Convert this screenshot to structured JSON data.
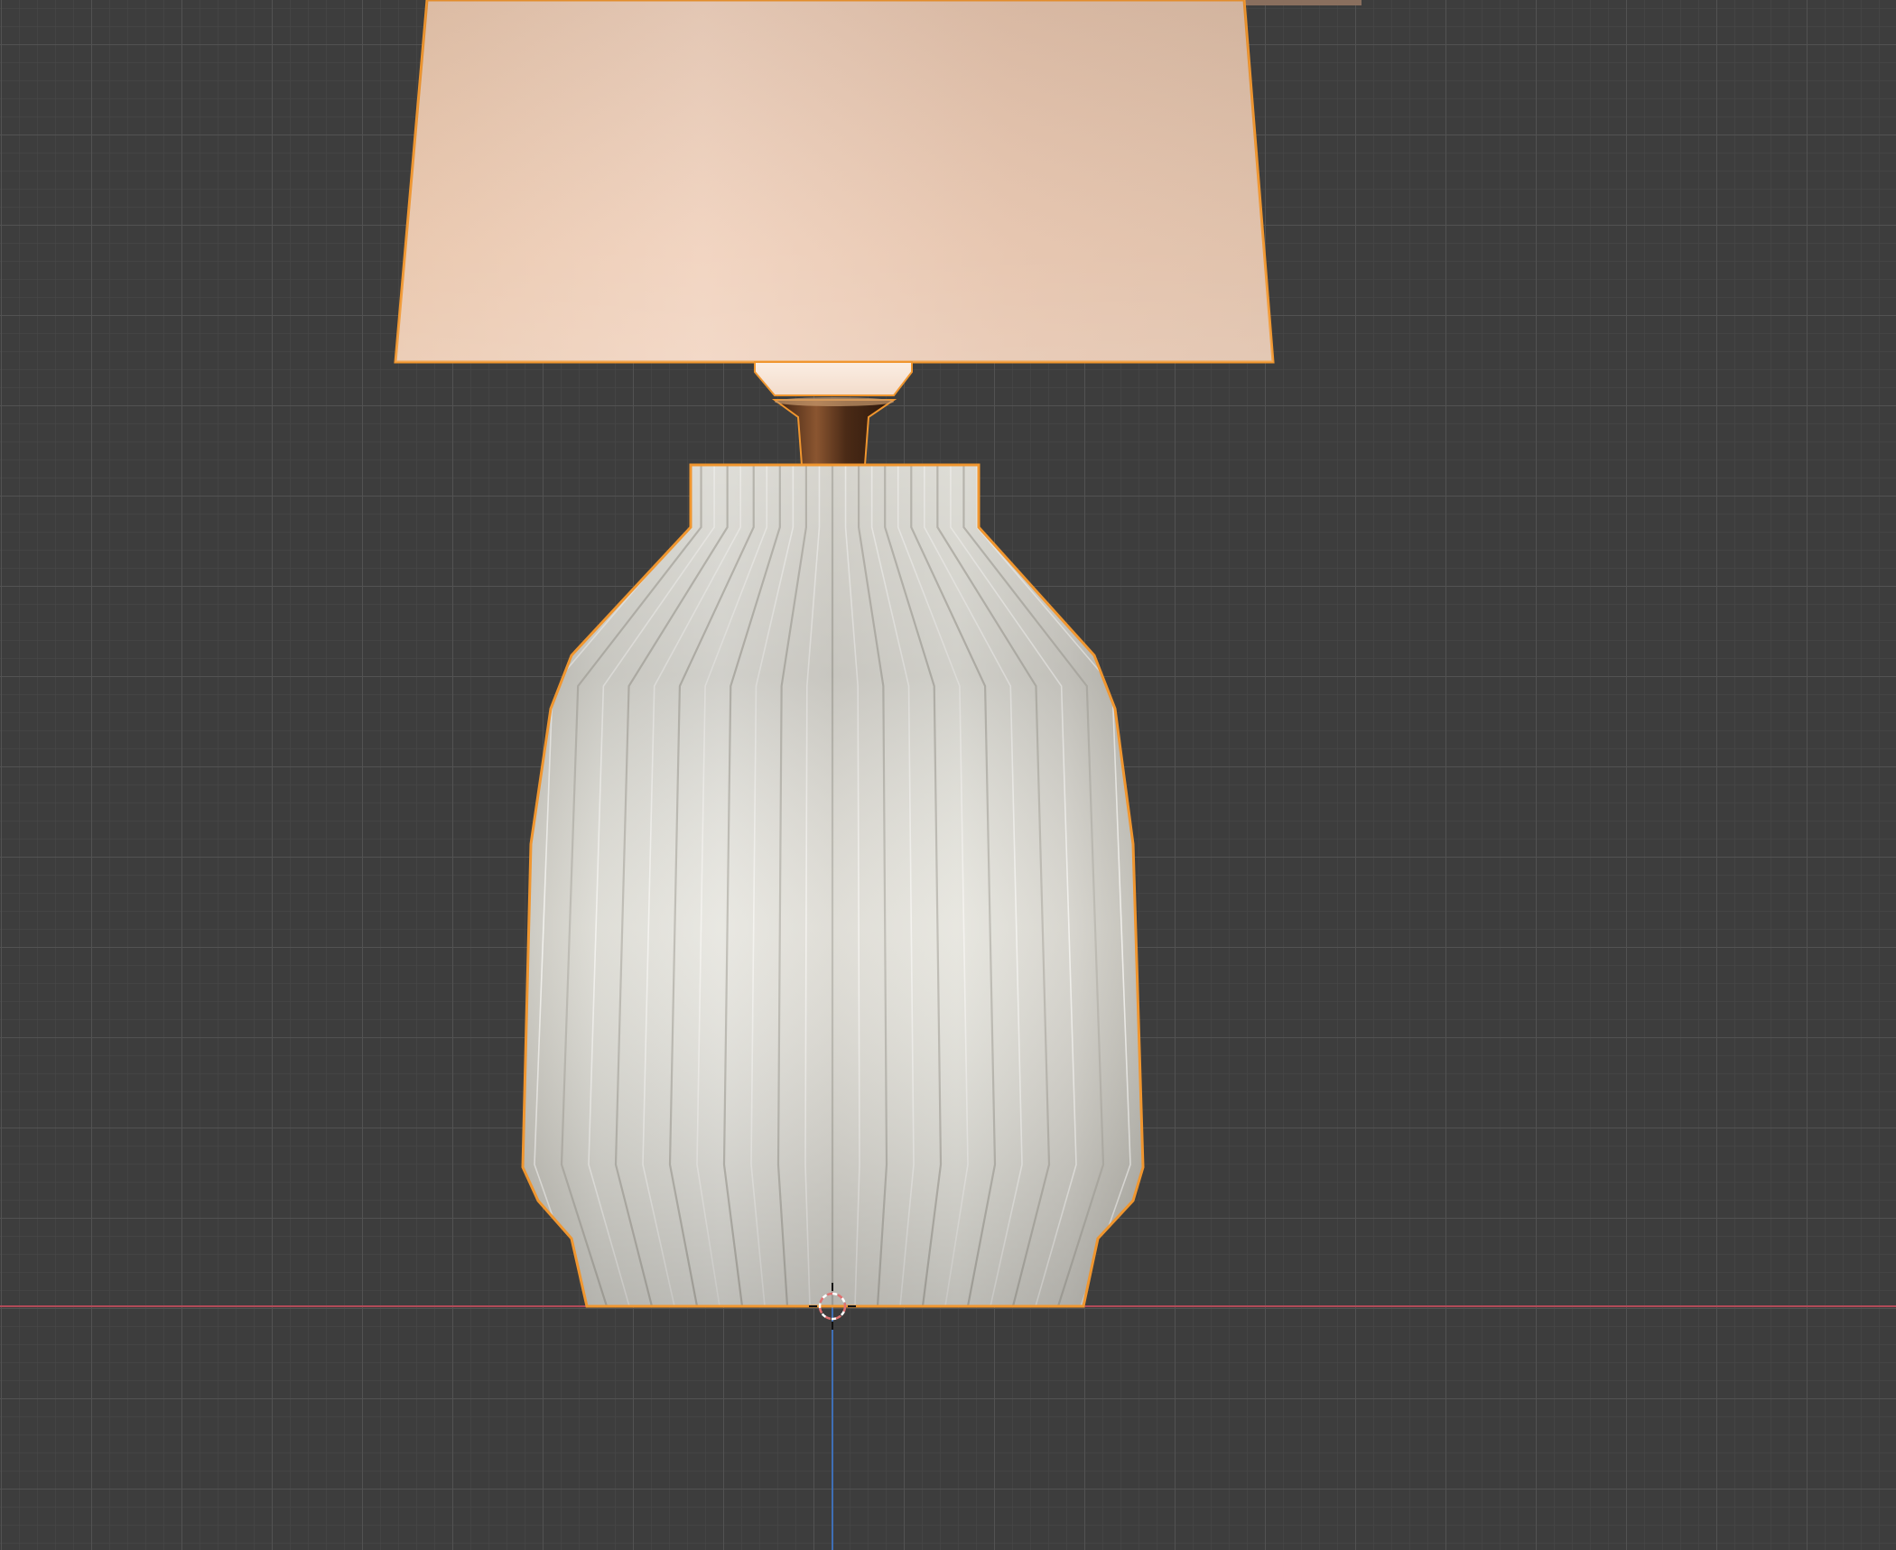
{
  "app": {
    "view": "3d-viewport",
    "projection": "orthographic-front",
    "shading": "material-preview"
  },
  "colors": {
    "background": "#3d3d3d",
    "grid_minor": "#474747",
    "grid_major": "#525252",
    "x_axis": "#b04a58",
    "z_axis": "#3f6fb5",
    "selection_outline": "#f0962f",
    "shade_light": "#f1d9c6",
    "shade_dark": "#e3bda3",
    "base_light": "#ecebe6",
    "base_mid": "#d4d3cc",
    "base_dark": "#a9a79f",
    "neck_bronze": "#5a331c",
    "cursor_red": "#e07070"
  },
  "icons": {
    "cursor": "3d-cursor-icon"
  },
  "scene": {
    "selected_object": "table-lamp",
    "parts": [
      "lamp-shade",
      "bulb",
      "neck",
      "ceramic-base"
    ]
  }
}
